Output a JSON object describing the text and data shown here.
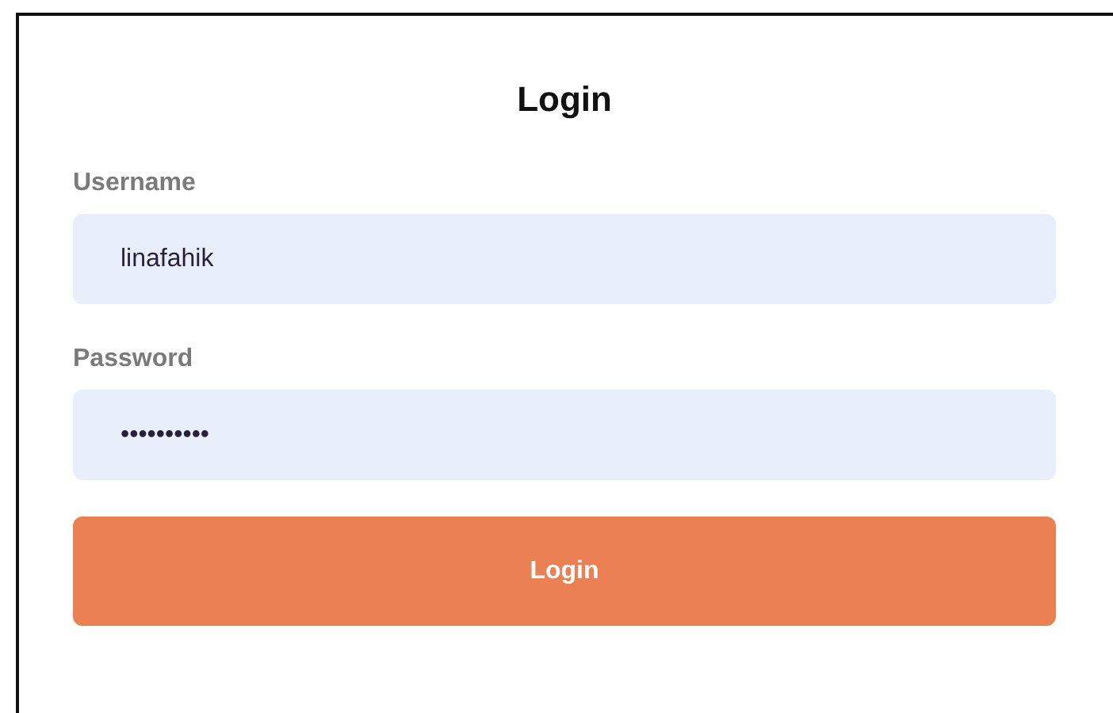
{
  "title": "Login",
  "fields": [
    {
      "label": "Username",
      "value": "linafahik"
    },
    {
      "label": "Password",
      "value": "••••••••••"
    }
  ],
  "button": {
    "label": "Login"
  }
}
